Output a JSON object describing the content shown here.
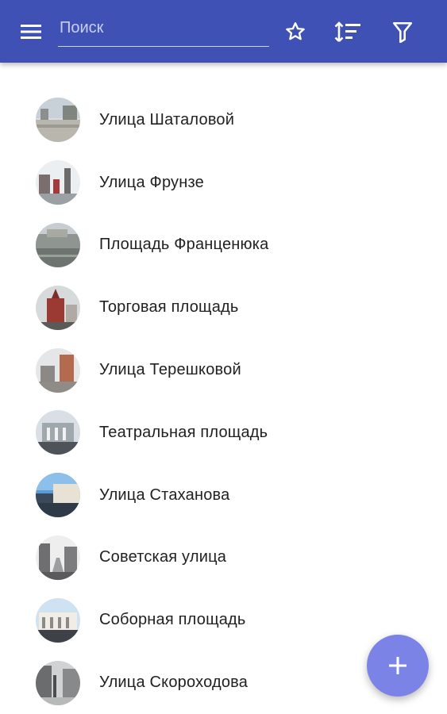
{
  "appbar": {
    "color": "#3f51b5",
    "menu_icon": "hamburger-icon",
    "search": {
      "placeholder": "Поиск",
      "value": ""
    },
    "actions": [
      "star-icon",
      "sort-icon",
      "filter-icon"
    ]
  },
  "streets": [
    {
      "name": "Улица Шаталовой",
      "photo": "street-photo"
    },
    {
      "name": "Улица Фрунзе",
      "photo": "street-photo"
    },
    {
      "name": "Площадь Франценюка",
      "photo": "square-photo"
    },
    {
      "name": "Торговая площадь",
      "photo": "square-photo"
    },
    {
      "name": "Улица Терешковой",
      "photo": "street-photo"
    },
    {
      "name": "Театральная площадь",
      "photo": "square-photo"
    },
    {
      "name": "Улица Стаханова",
      "photo": "street-photo"
    },
    {
      "name": "Советская улица",
      "photo": "street-photo"
    },
    {
      "name": "Соборная площадь",
      "photo": "square-photo"
    },
    {
      "name": "Улица Скороходова",
      "photo": "street-photo"
    }
  ],
  "fab": {
    "icon": "plus-icon",
    "color": "#7b84e6"
  }
}
